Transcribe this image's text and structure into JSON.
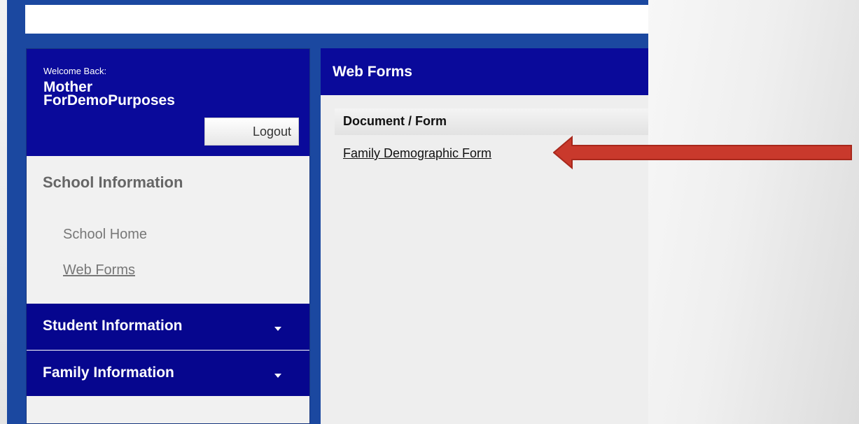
{
  "sidebar": {
    "welcome_label": "Welcome Back:",
    "user_first": "Mother",
    "user_last": "ForDemoPurposes",
    "logout_label": "Logout",
    "school_section": "School Information",
    "school_links": [
      "School Home",
      "Web Forms"
    ],
    "sections": [
      {
        "label": "Student Information",
        "icon": "chevron-down-icon"
      },
      {
        "label": "Family Information",
        "icon": "chevron-down-icon"
      }
    ]
  },
  "main": {
    "title": "Web Forms",
    "column_header": "Document / Form",
    "forms": [
      "Family Demographic Form"
    ]
  },
  "colors": {
    "header_navy": "#0a0a9a",
    "frame_blue": "#1b48a0",
    "annotation_red": "#c9392c"
  }
}
